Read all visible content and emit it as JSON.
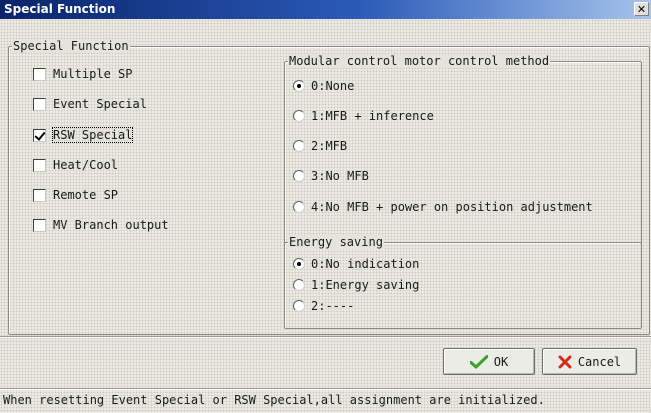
{
  "window": {
    "title": "Special Function",
    "close_glyph": "✕"
  },
  "special_function": {
    "legend": "Special Function",
    "items": [
      {
        "label": "Multiple SP",
        "checked": false
      },
      {
        "label": "Event Special",
        "checked": false
      },
      {
        "label": "RSW Special",
        "checked": true
      },
      {
        "label": "Heat/Cool",
        "checked": false
      },
      {
        "label": "Remote SP",
        "checked": false
      },
      {
        "label": "MV Branch output",
        "checked": false
      }
    ]
  },
  "modular_control": {
    "legend": "Modular control motor control method",
    "options": [
      {
        "label": "0:None",
        "selected": true
      },
      {
        "label": "1:MFB + inference",
        "selected": false
      },
      {
        "label": "2:MFB",
        "selected": false
      },
      {
        "label": "3:No MFB",
        "selected": false
      },
      {
        "label": "4:No MFB + power on position adjustment",
        "selected": false
      }
    ]
  },
  "energy_saving": {
    "legend": "Energy saving",
    "options": [
      {
        "label": "0:No indication",
        "selected": true
      },
      {
        "label": "1:Energy saving",
        "selected": false
      },
      {
        "label": "2:----",
        "selected": false
      }
    ]
  },
  "buttons": {
    "ok_label": "OK",
    "cancel_label": "Cancel"
  },
  "status": {
    "message": "When resetting Event Special or RSW Special,all assignment are initialized."
  },
  "colors": {
    "ok_check": "#3aa12a",
    "cancel_x": "#d42a1a",
    "title_bar": "#0a246a"
  }
}
